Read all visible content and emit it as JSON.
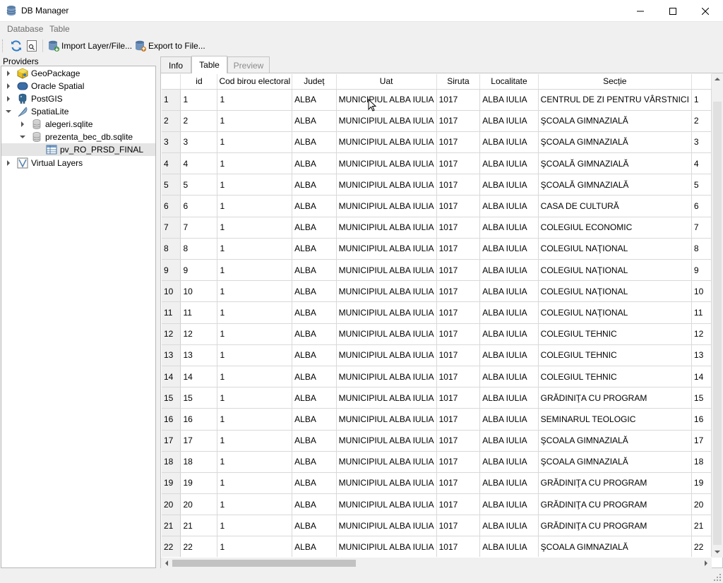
{
  "window": {
    "title": "DB Manager"
  },
  "menu": [
    {
      "label": "Database",
      "mnemonic": "D"
    },
    {
      "label": "Table",
      "mnemonic": "T"
    }
  ],
  "toolbar": {
    "import_label": "Import Layer/File...",
    "export_label": "Export to File..."
  },
  "providers": {
    "label": "Providers",
    "items": [
      {
        "label": "GeoPackage",
        "icon": "geopackage-icon",
        "level": 0,
        "expanded": false
      },
      {
        "label": "Oracle Spatial",
        "icon": "oracle-icon",
        "level": 0,
        "expanded": false
      },
      {
        "label": "PostGIS",
        "icon": "postgis-elephant-icon",
        "level": 0,
        "expanded": false
      },
      {
        "label": "SpatiaLite",
        "icon": "spatialite-feather-icon",
        "level": 0,
        "expanded": true
      },
      {
        "label": "alegeri.sqlite",
        "icon": "database-icon",
        "level": 1,
        "expanded": false
      },
      {
        "label": "prezenta_bec_db.sqlite",
        "icon": "database-icon",
        "level": 1,
        "expanded": true
      },
      {
        "label": "pv_RO_PRSD_FINAL",
        "icon": "table-icon",
        "level": 2,
        "selected": true
      },
      {
        "label": "Virtual Layers",
        "icon": "virtual-layers-icon",
        "level": 0,
        "expanded": false
      }
    ]
  },
  "tabs": [
    {
      "label": "Info",
      "state": "normal"
    },
    {
      "label": "Table",
      "state": "active"
    },
    {
      "label": "Preview",
      "state": "disabled"
    }
  ],
  "table": {
    "columns": [
      "id",
      "Cod birou electoral",
      "Județ",
      "Uat",
      "Siruta",
      "Localitate",
      "Secție",
      ""
    ],
    "rows": [
      [
        "1",
        "1",
        "1",
        "ALBA",
        "MUNICIPIUL ALBA IULIA",
        "1017",
        "ALBA IULIA",
        "CENTRUL DE ZI PENTRU VÂRSTNICI",
        "1"
      ],
      [
        "2",
        "2",
        "1",
        "ALBA",
        "MUNICIPIUL ALBA IULIA",
        "1017",
        "ALBA IULIA",
        "ŞCOALA GIMNAZIALĂ",
        "2"
      ],
      [
        "3",
        "3",
        "1",
        "ALBA",
        "MUNICIPIUL ALBA IULIA",
        "1017",
        "ALBA IULIA",
        "ŞCOALA GIMNAZIALĂ",
        "3"
      ],
      [
        "4",
        "4",
        "1",
        "ALBA",
        "MUNICIPIUL ALBA IULIA",
        "1017",
        "ALBA IULIA",
        "ŞCOALĂ GIMNAZIALĂ",
        "4"
      ],
      [
        "5",
        "5",
        "1",
        "ALBA",
        "MUNICIPIUL ALBA IULIA",
        "1017",
        "ALBA IULIA",
        "ŞCOALĂ GIMNAZIALĂ",
        "5"
      ],
      [
        "6",
        "6",
        "1",
        "ALBA",
        "MUNICIPIUL ALBA IULIA",
        "1017",
        "ALBA IULIA",
        "CASA DE CULTURĂ",
        "6"
      ],
      [
        "7",
        "7",
        "1",
        "ALBA",
        "MUNICIPIUL ALBA IULIA",
        "1017",
        "ALBA IULIA",
        "COLEGIUL ECONOMIC",
        "7"
      ],
      [
        "8",
        "8",
        "1",
        "ALBA",
        "MUNICIPIUL ALBA IULIA",
        "1017",
        "ALBA IULIA",
        "COLEGIUL NAŢIONAL",
        "8"
      ],
      [
        "9",
        "9",
        "1",
        "ALBA",
        "MUNICIPIUL ALBA IULIA",
        "1017",
        "ALBA IULIA",
        "COLEGIUL NAŢIONAL",
        "9"
      ],
      [
        "10",
        "10",
        "1",
        "ALBA",
        "MUNICIPIUL ALBA IULIA",
        "1017",
        "ALBA IULIA",
        "COLEGIUL NAŢIONAL",
        "10"
      ],
      [
        "11",
        "11",
        "1",
        "ALBA",
        "MUNICIPIUL ALBA IULIA",
        "1017",
        "ALBA IULIA",
        "COLEGIUL NAŢIONAL",
        "11"
      ],
      [
        "12",
        "12",
        "1",
        "ALBA",
        "MUNICIPIUL ALBA IULIA",
        "1017",
        "ALBA IULIA",
        "COLEGIUL TEHNIC",
        "12"
      ],
      [
        "13",
        "13",
        "1",
        "ALBA",
        "MUNICIPIUL ALBA IULIA",
        "1017",
        "ALBA IULIA",
        "COLEGIUL TEHNIC",
        "13"
      ],
      [
        "14",
        "14",
        "1",
        "ALBA",
        "MUNICIPIUL ALBA IULIA",
        "1017",
        "ALBA IULIA",
        "COLEGIUL TEHNIC",
        "14"
      ],
      [
        "15",
        "15",
        "1",
        "ALBA",
        "MUNICIPIUL ALBA IULIA",
        "1017",
        "ALBA IULIA",
        "GRĂDINIŢA CU PROGRAM",
        "15"
      ],
      [
        "16",
        "16",
        "1",
        "ALBA",
        "MUNICIPIUL ALBA IULIA",
        "1017",
        "ALBA IULIA",
        "SEMINARUL TEOLOGIC",
        "16"
      ],
      [
        "17",
        "17",
        "1",
        "ALBA",
        "MUNICIPIUL ALBA IULIA",
        "1017",
        "ALBA IULIA",
        "ŞCOALA GIMNAZIALĂ",
        "17"
      ],
      [
        "18",
        "18",
        "1",
        "ALBA",
        "MUNICIPIUL ALBA IULIA",
        "1017",
        "ALBA IULIA",
        "ŞCOALA GIMNAZIALĂ",
        "18"
      ],
      [
        "19",
        "19",
        "1",
        "ALBA",
        "MUNICIPIUL ALBA IULIA",
        "1017",
        "ALBA IULIA",
        "GRĂDINIŢA CU PROGRAM",
        "19"
      ],
      [
        "20",
        "20",
        "1",
        "ALBA",
        "MUNICIPIUL ALBA IULIA",
        "1017",
        "ALBA IULIA",
        "GRĂDINIŢA CU PROGRAM",
        "20"
      ],
      [
        "21",
        "21",
        "1",
        "ALBA",
        "MUNICIPIUL ALBA IULIA",
        "1017",
        "ALBA IULIA",
        "GRĂDINIŢA CU PROGRAM",
        "21"
      ],
      [
        "22",
        "22",
        "1",
        "ALBA",
        "MUNICIPIUL ALBA IULIA",
        "1017",
        "ALBA IULIA",
        "ŞCOALA GIMNAZIALĂ",
        "22"
      ]
    ]
  },
  "colors": {
    "selection": "#e5e5e5",
    "header_bg": "#ffffff",
    "row_header_bg": "#f0f0f0"
  }
}
